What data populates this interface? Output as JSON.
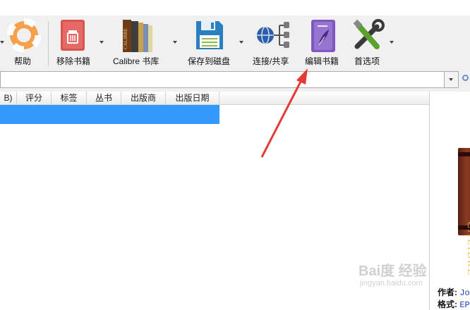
{
  "toolbar": {
    "help_label": "帮助",
    "remove_label": "移除书籍",
    "library_label": "Calibre 书库",
    "save_label": "保存到磁盘",
    "connect_label": "连接/共享",
    "edit_label": "编辑书籍",
    "prefs_label": "首选项"
  },
  "library_icon_text": "CALIBRE",
  "table": {
    "headers": [
      "B)",
      "评分",
      "标签",
      "丛书",
      "出版商",
      "出版日期"
    ]
  },
  "book_cover_text": "CALIBRE",
  "details": {
    "author_label": "作者:",
    "author_value": "Jo",
    "format_label": "格式:",
    "format_value": "EP"
  },
  "watermark": {
    "line1": "Bai度 经验",
    "line2": "jingyan.baidu.com"
  },
  "colors": {
    "selection": "#3399ff",
    "arrow": "#e53935"
  }
}
